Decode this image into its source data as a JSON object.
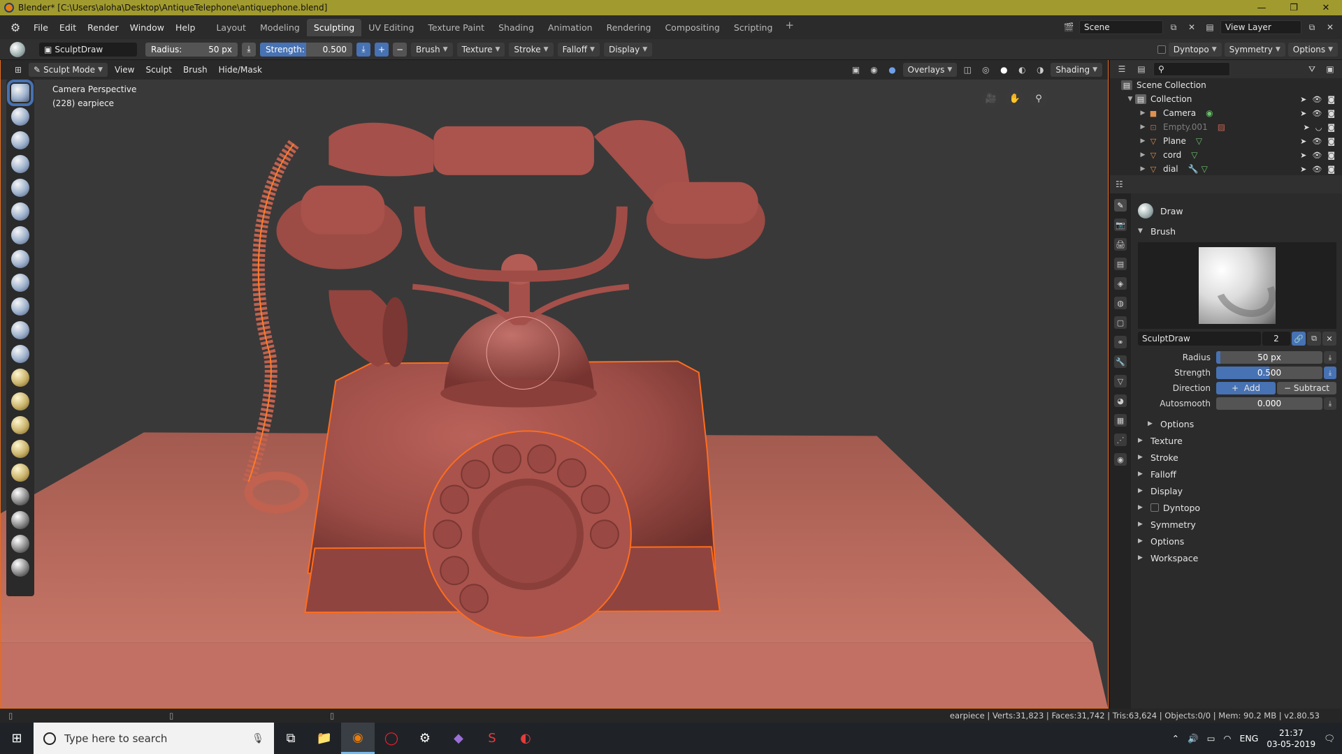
{
  "window": {
    "title": "Blender* [C:\\Users\\aloha\\Desktop\\AntiqueTelephone\\antiquephone.blend]",
    "minimize": "—",
    "maximize": "❐",
    "close": "✕"
  },
  "menubar": {
    "menus": [
      "File",
      "Edit",
      "Render",
      "Window",
      "Help"
    ],
    "workspaces": [
      "Layout",
      "Modeling",
      "Sculpting",
      "UV Editing",
      "Texture Paint",
      "Shading",
      "Animation",
      "Rendering",
      "Compositing",
      "Scripting"
    ],
    "active_workspace": "Sculpting",
    "add_workspace": "+",
    "scene_name": "Scene",
    "view_layer": "View Layer"
  },
  "toolheader": {
    "brush_name": "SculptDraw",
    "radius_label": "Radius:",
    "radius_value": "50 px",
    "strength_label": "Strength:",
    "strength_value": "0.500",
    "strength_fraction": 0.5,
    "add_symbol": "+",
    "sub_symbol": "−",
    "menus": [
      "Brush",
      "Texture",
      "Stroke",
      "Falloff",
      "Display"
    ],
    "dyntopo": "Dyntopo",
    "symmetry": "Symmetry",
    "options": "Options"
  },
  "viewport": {
    "mode": "Sculpt Mode",
    "menus": [
      "View",
      "Sculpt",
      "Brush",
      "Hide/Mask"
    ],
    "overlays": "Overlays",
    "shading": "Shading",
    "info_line1": "Camera Perspective",
    "info_line2": "(228) earpiece"
  },
  "outliner": {
    "root": "Scene Collection",
    "collection": "Collection",
    "items": [
      {
        "name": "Camera",
        "dim": false
      },
      {
        "name": "Empty.001",
        "dim": true
      },
      {
        "name": "Plane",
        "dim": false
      },
      {
        "name": "cord",
        "dim": false
      },
      {
        "name": "dial",
        "dim": false
      }
    ]
  },
  "properties": {
    "tool_name": "Draw",
    "brush_panel": "Brush",
    "brush_datablock": "SculptDraw",
    "brush_users": "2",
    "radius_label": "Radius",
    "radius_value": "50 px",
    "strength_label": "Strength",
    "strength_value": "0.500",
    "strength_fraction": 0.5,
    "direction_label": "Direction",
    "direction_add": "Add",
    "direction_subtract": "Subtract",
    "autosmooth_label": "Autosmooth",
    "autosmooth_value": "0.000",
    "options_sub": "Options",
    "panels": [
      "Texture",
      "Stroke",
      "Falloff",
      "Display",
      "Dyntopo",
      "Symmetry",
      "Options",
      "Workspace"
    ]
  },
  "statusbar": {
    "stats": "earpiece | Verts:31,823 | Faces:31,742 | Tris:63,624 | Objects:0/0 | Mem: 90.2 MB | v2.80.53"
  },
  "taskbar": {
    "search_placeholder": "Type here to search",
    "language": "ENG",
    "time": "21:37",
    "date": "03-05-2019"
  },
  "colors": {
    "accent": "#4772b3",
    "selection_outline": "#e86b1f",
    "mesh": "#a5504a",
    "floor": "#b96a5c",
    "title_bar": "#a19a2f"
  }
}
